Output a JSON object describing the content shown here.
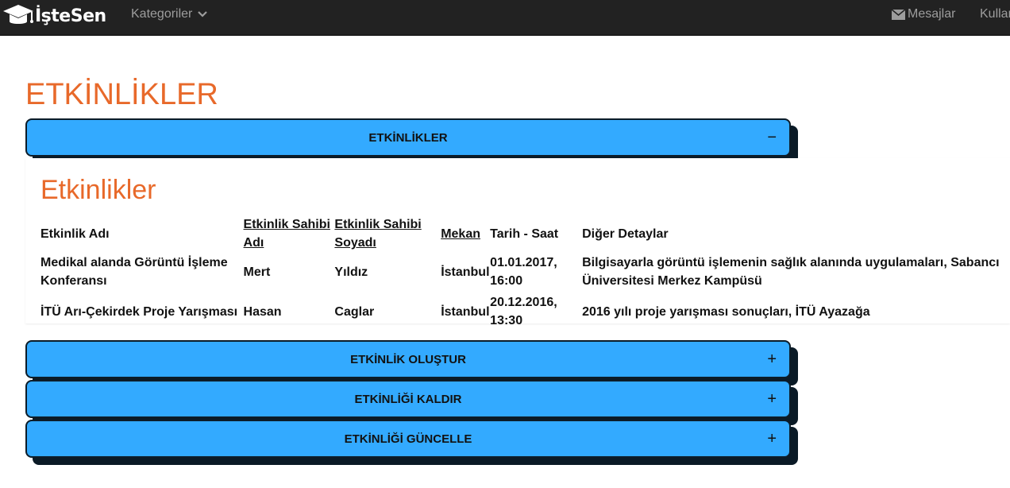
{
  "navbar": {
    "brand": "İşteSen",
    "brand_icon": "graduation-cap-icon",
    "categories_label": "Kategoriler",
    "messages_label": "Mesajlar",
    "user_label": "Kullan"
  },
  "page": {
    "title": "ETKİNLİKLER"
  },
  "accordion": [
    {
      "label": "ETKİNLİKLER",
      "toggle": "−",
      "expanded": true
    },
    {
      "label": "ETKİNLİK OLUŞTUR",
      "toggle": "+",
      "expanded": false
    },
    {
      "label": "ETKİNLİĞİ KALDIR",
      "toggle": "+",
      "expanded": false
    },
    {
      "label": "ETKİNLİĞİ GÜNCELLE",
      "toggle": "+",
      "expanded": false
    }
  ],
  "events": {
    "title": "Etkinlikler",
    "columns": [
      "Etkinlik Adı",
      "Etkinlik Sahibi Adı",
      "Etkinlik Sahibi Soyadı",
      "Mekan",
      "Tarih - Saat",
      "Diğer Detaylar"
    ],
    "rows": [
      [
        "Medikal alanda Görüntü İşleme Konferansı",
        "Mert",
        "Yıldız",
        "İstanbul",
        "01.01.2017, 16:00",
        "Bilgisayarla görüntü işlemenin sağlık alanında uygulamaları, Sabancı Üniversitesi Merkez Kampüsü"
      ],
      [
        "İTÜ Arı-Çekirdek Proje Yarışması",
        "Hasan",
        "Caglar",
        "İstanbul",
        "20.12.2016, 13:30",
        "2016 yılı proje yarışması sonuçları, İTÜ Ayazağa"
      ]
    ]
  },
  "colors": {
    "navbar_bg": "#222222",
    "nav_text": "#9d9d9d",
    "accent_orange": "#e8692a",
    "accordion_blue": "#33aaff",
    "accordion_shadow": "#0a1a26"
  }
}
